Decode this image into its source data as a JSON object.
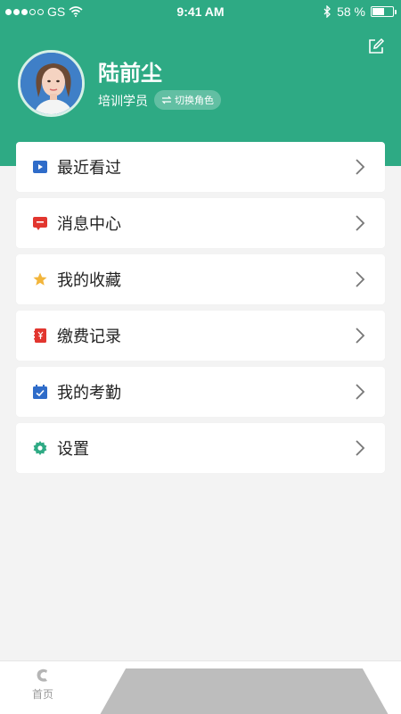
{
  "status_bar": {
    "carrier": "GS",
    "time": "9:41 AM",
    "battery": "58 %",
    "battery_level": 0.58
  },
  "profile": {
    "name": "陆前尘",
    "role": "培训学员",
    "switch_role_label": "切换角色"
  },
  "menu": [
    {
      "label": "最近看过",
      "icon": "recent-video-icon",
      "color": "#2f6cc9"
    },
    {
      "label": "消息中心",
      "icon": "message-icon",
      "color": "#e2362f"
    },
    {
      "label": "我的收藏",
      "icon": "star-icon",
      "color": "#f2b53b"
    },
    {
      "label": "缴费记录",
      "icon": "payment-record-icon",
      "color": "#e2362f"
    },
    {
      "label": "我的考勤",
      "icon": "calendar-check-icon",
      "color": "#2f6cc9"
    },
    {
      "label": "设置",
      "icon": "gear-icon",
      "color": "#2eaa84"
    }
  ],
  "tabbar": {
    "home_label": "首页"
  },
  "colors": {
    "header": "#2eaa84",
    "background": "#f3f3f3"
  }
}
